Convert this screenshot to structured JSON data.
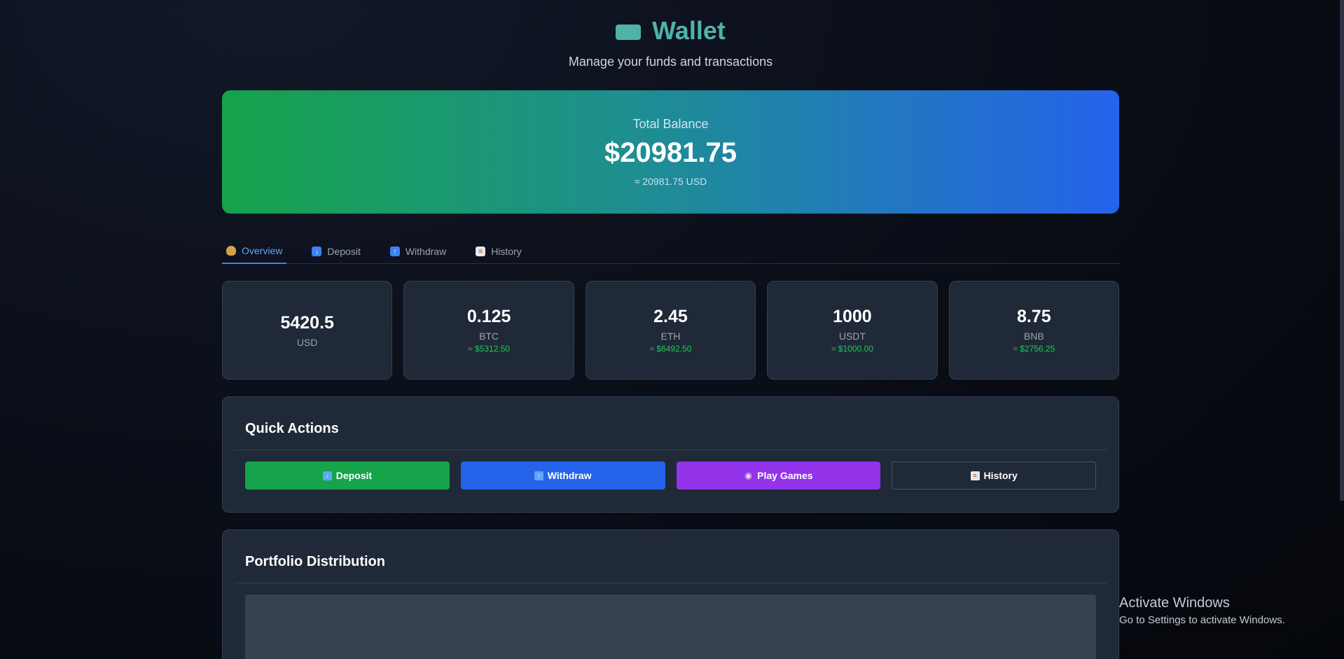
{
  "header": {
    "icon": "wallet-icon",
    "title": "Wallet",
    "subtitle": "Manage your funds and transactions"
  },
  "balance": {
    "label": "Total Balance",
    "value": "$20981.75",
    "approx": "≈ 20981.75 USD"
  },
  "tabs": [
    {
      "label": "Overview",
      "icon": "money-bag-icon",
      "active": true
    },
    {
      "label": "Deposit",
      "icon": "down-arrow-icon",
      "active": false
    },
    {
      "label": "Withdraw",
      "icon": "up-arrow-icon",
      "active": false
    },
    {
      "label": "History",
      "icon": "clipboard-icon",
      "active": false
    }
  ],
  "assets": [
    {
      "amount": "5420.5",
      "code": "USD",
      "usd": ""
    },
    {
      "amount": "0.125",
      "code": "BTC",
      "usd": "≈ $5312.50"
    },
    {
      "amount": "2.45",
      "code": "ETH",
      "usd": "≈ $6492.50"
    },
    {
      "amount": "1000",
      "code": "USDT",
      "usd": "≈ $1000.00"
    },
    {
      "amount": "8.75",
      "code": "BNB",
      "usd": "≈ $2756.25"
    }
  ],
  "quick_actions": {
    "title": "Quick Actions",
    "buttons": [
      {
        "label": "Deposit",
        "icon": "down-arrow-icon",
        "color": "#16a34a"
      },
      {
        "label": "Withdraw",
        "icon": "up-arrow-icon",
        "color": "#2563eb"
      },
      {
        "label": "Play Games",
        "icon": "gamepad-icon",
        "color": "#9333ea"
      },
      {
        "label": "History",
        "icon": "clipboard-icon",
        "color": "#1f2937"
      }
    ]
  },
  "portfolio": {
    "title": "Portfolio Distribution"
  },
  "watermark": {
    "title": "Activate Windows",
    "subtitle": "Go to Settings to activate Windows."
  },
  "colors": {
    "accent": "#4fb3a9",
    "tab_active": "#60a5fa",
    "positive": "#22c55e"
  }
}
